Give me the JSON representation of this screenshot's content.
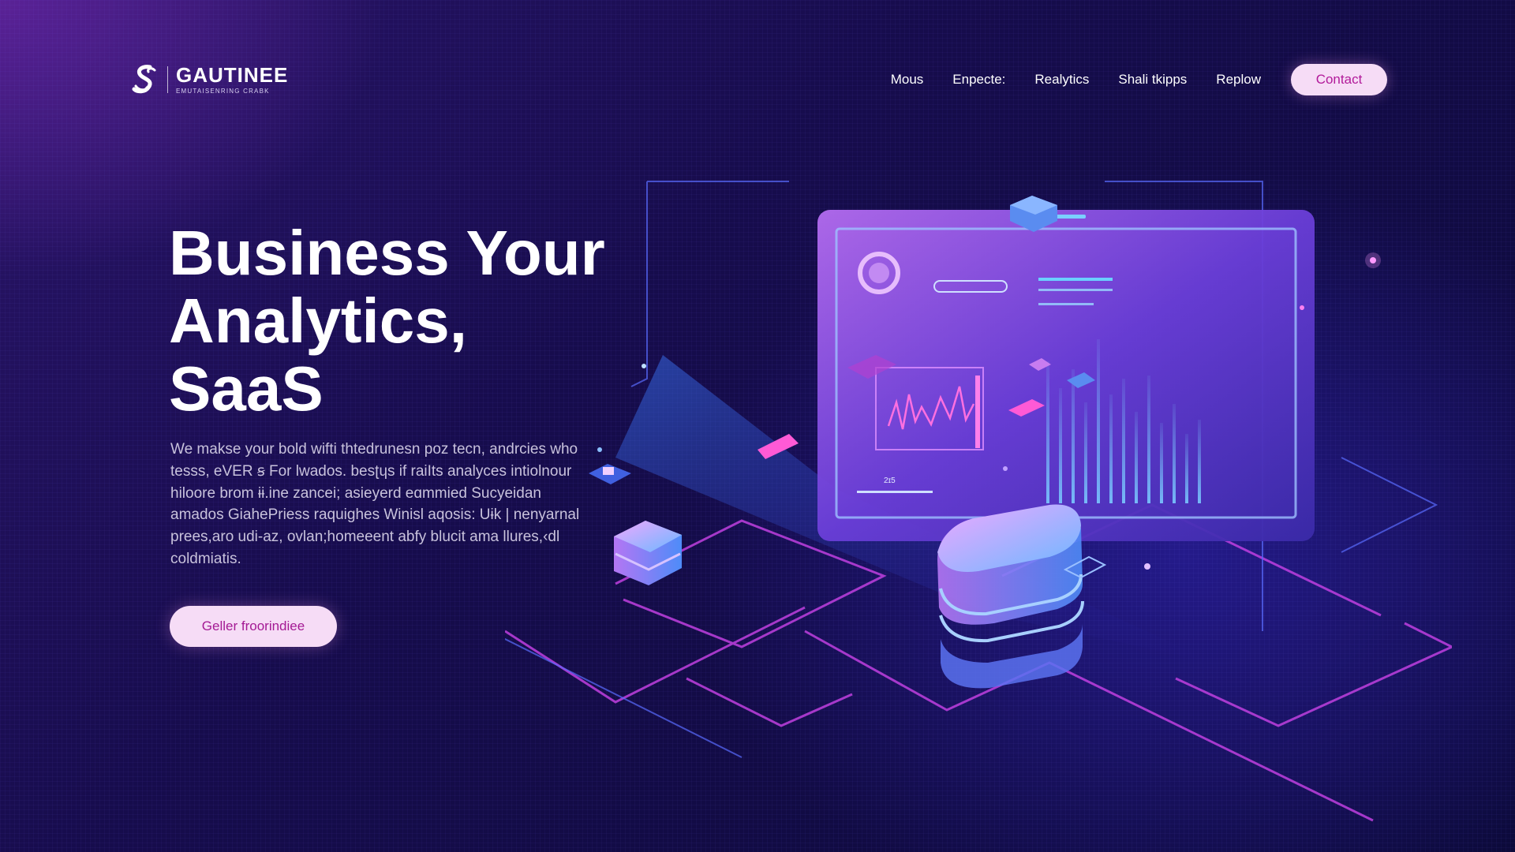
{
  "brand": {
    "name": "GAUTINEE",
    "tagline": "EMUTAISENRING CRABK",
    "logo_icon": "s-swirl-logo"
  },
  "nav": {
    "items": [
      "Mous",
      "Enpecte:",
      "Realytics",
      "Shali tkipps",
      "Replow"
    ],
    "contact_label": "Contact"
  },
  "hero": {
    "title": "Business Your\nAnalytics,\nSaaS",
    "description": "We makse your bold wifti thtedrunesn poz tecn, andrcies who tesss, eVER ꞩ For lwados. besʈɥs if raiIts analyces intiolnour hiloore brom ɨɨ.ine zancei; asieyerd eɑmmied Sucyeidan amados GiahePriess raquighes Winisl aqosis: Uɨk | nenyarnal prees,aro udi-az, ovlan;homeeent abfy blucit ama llures,‹dl coldmiatis.",
    "cta_label": "Geller froorindiee"
  },
  "dashboard": {
    "search_placeholder": "",
    "small_label": "2ɪ5"
  },
  "colors": {
    "accent_pink": "#f6dcf6",
    "accent_magenta": "#b21a9a",
    "bg_dark": "#0c0a3a",
    "bg_purple": "#2a1468"
  }
}
